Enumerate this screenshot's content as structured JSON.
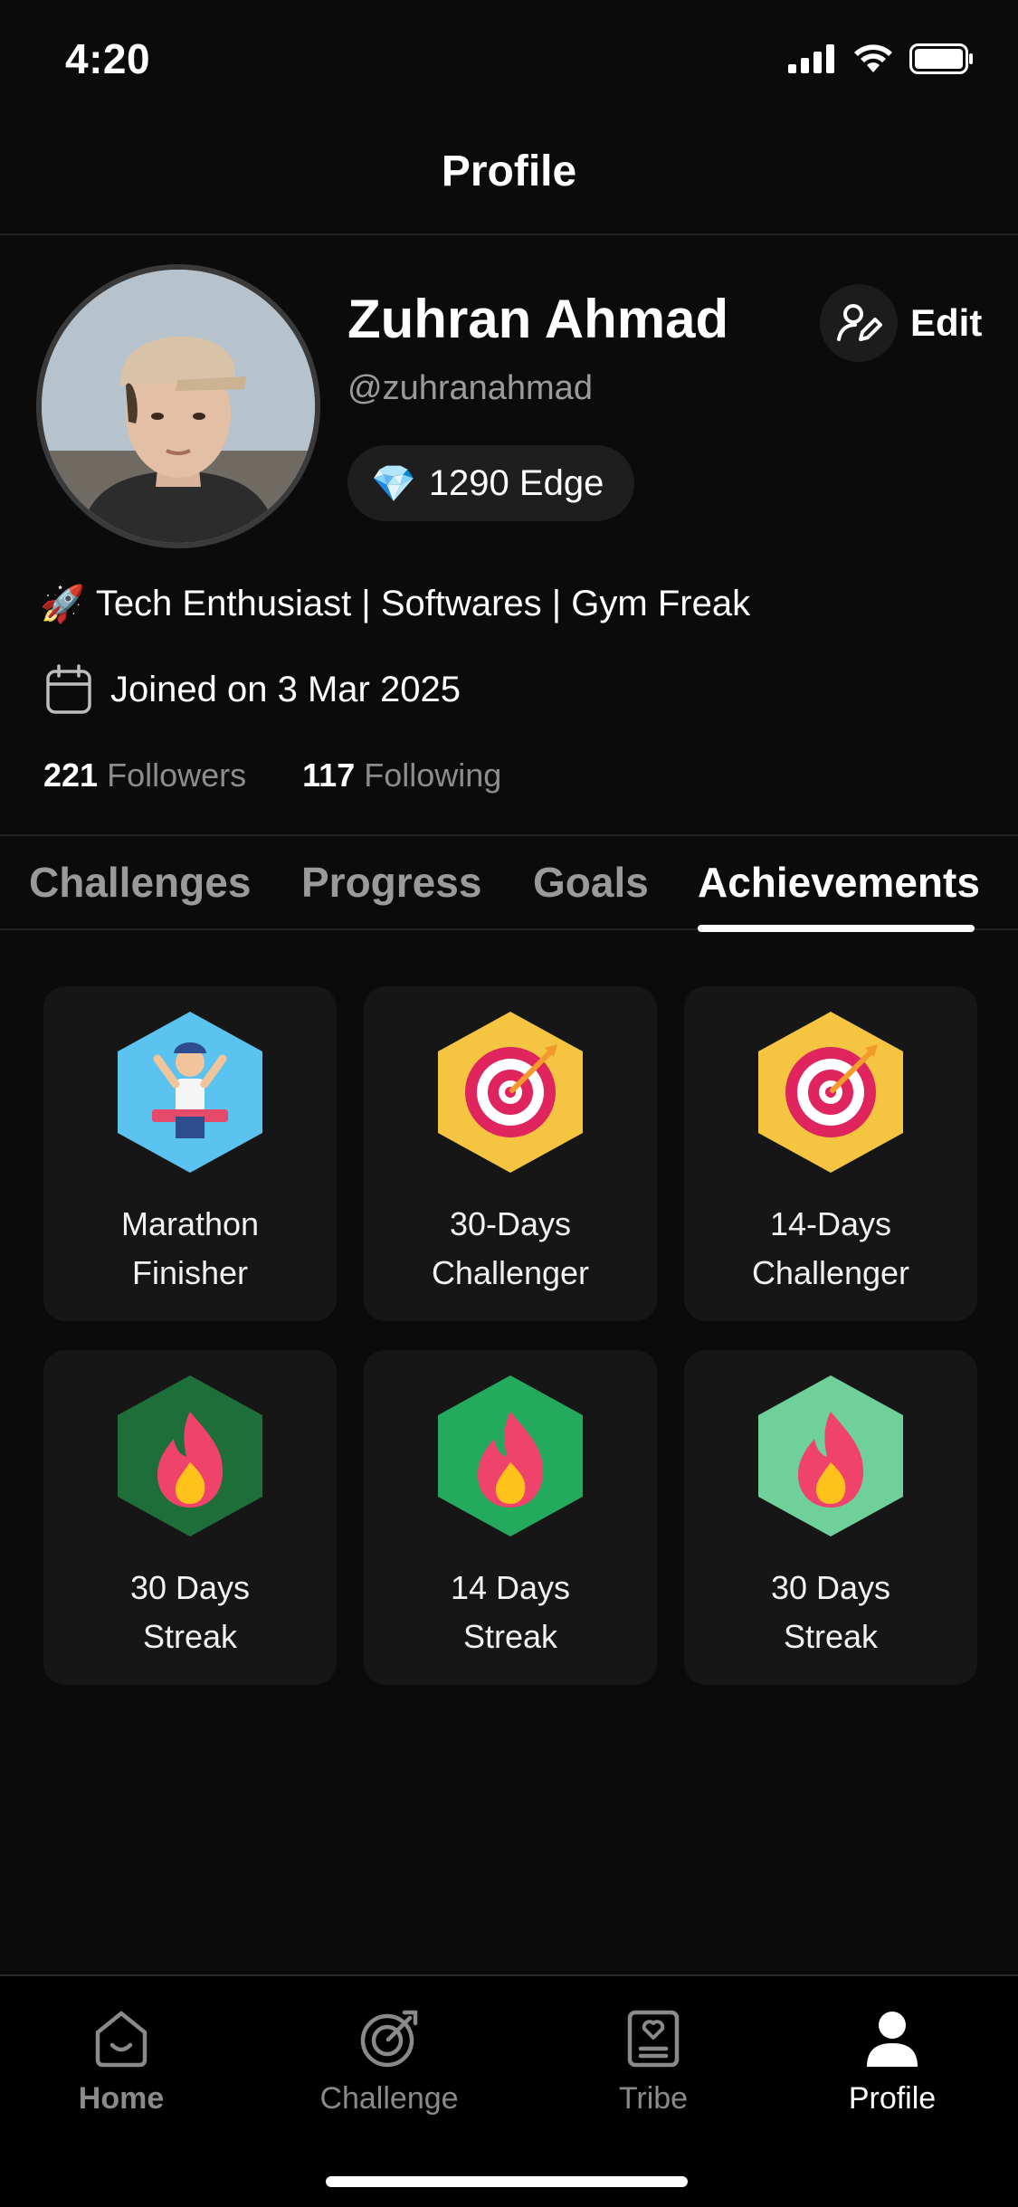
{
  "status_bar": {
    "time": "4:20"
  },
  "header": {
    "title": "Profile"
  },
  "profile": {
    "name": "Zuhran Ahmad",
    "handle": "@zuhranahmad",
    "edge_icon": "💎",
    "edge_text": "1290 Edge",
    "edit_label": "Edit",
    "bio_icon": "🚀",
    "bio": "Tech Enthusiast | Softwares | Gym Freak",
    "joined": "Joined on 3 Mar 2025",
    "followers_count": "221",
    "followers_label": "Followers",
    "following_count": "117",
    "following_label": "Following"
  },
  "tabs": [
    {
      "label": "Challenges"
    },
    {
      "label": "Progress"
    },
    {
      "label": "Goals"
    },
    {
      "label": "Achievements",
      "active": true
    }
  ],
  "achievements": [
    {
      "line1": "Marathon",
      "line2": "Finisher",
      "icon": "runner-icon",
      "color": "#5bc3ef"
    },
    {
      "line1": "30-Days",
      "line2": "Challenger",
      "icon": "target-icon",
      "color": "#f5c542"
    },
    {
      "line1": "14-Days",
      "line2": "Challenger",
      "icon": "target-icon",
      "color": "#f5c542"
    },
    {
      "line1": "30 Days",
      "line2": "Streak",
      "icon": "flame-icon",
      "color": "#1e6e3a"
    },
    {
      "line1": "14 Days",
      "line2": "Streak",
      "icon": "flame-icon",
      "color": "#24aa5c"
    },
    {
      "line1": "30 Days",
      "line2": "Streak",
      "icon": "flame-icon",
      "color": "#6fd09a"
    }
  ],
  "bottom_nav": [
    {
      "label": "Home",
      "icon": "home-icon"
    },
    {
      "label": "Challenge",
      "icon": "challenge-icon"
    },
    {
      "label": "Tribe",
      "icon": "tribe-icon"
    },
    {
      "label": "Profile",
      "icon": "profile-icon",
      "active": true
    }
  ]
}
